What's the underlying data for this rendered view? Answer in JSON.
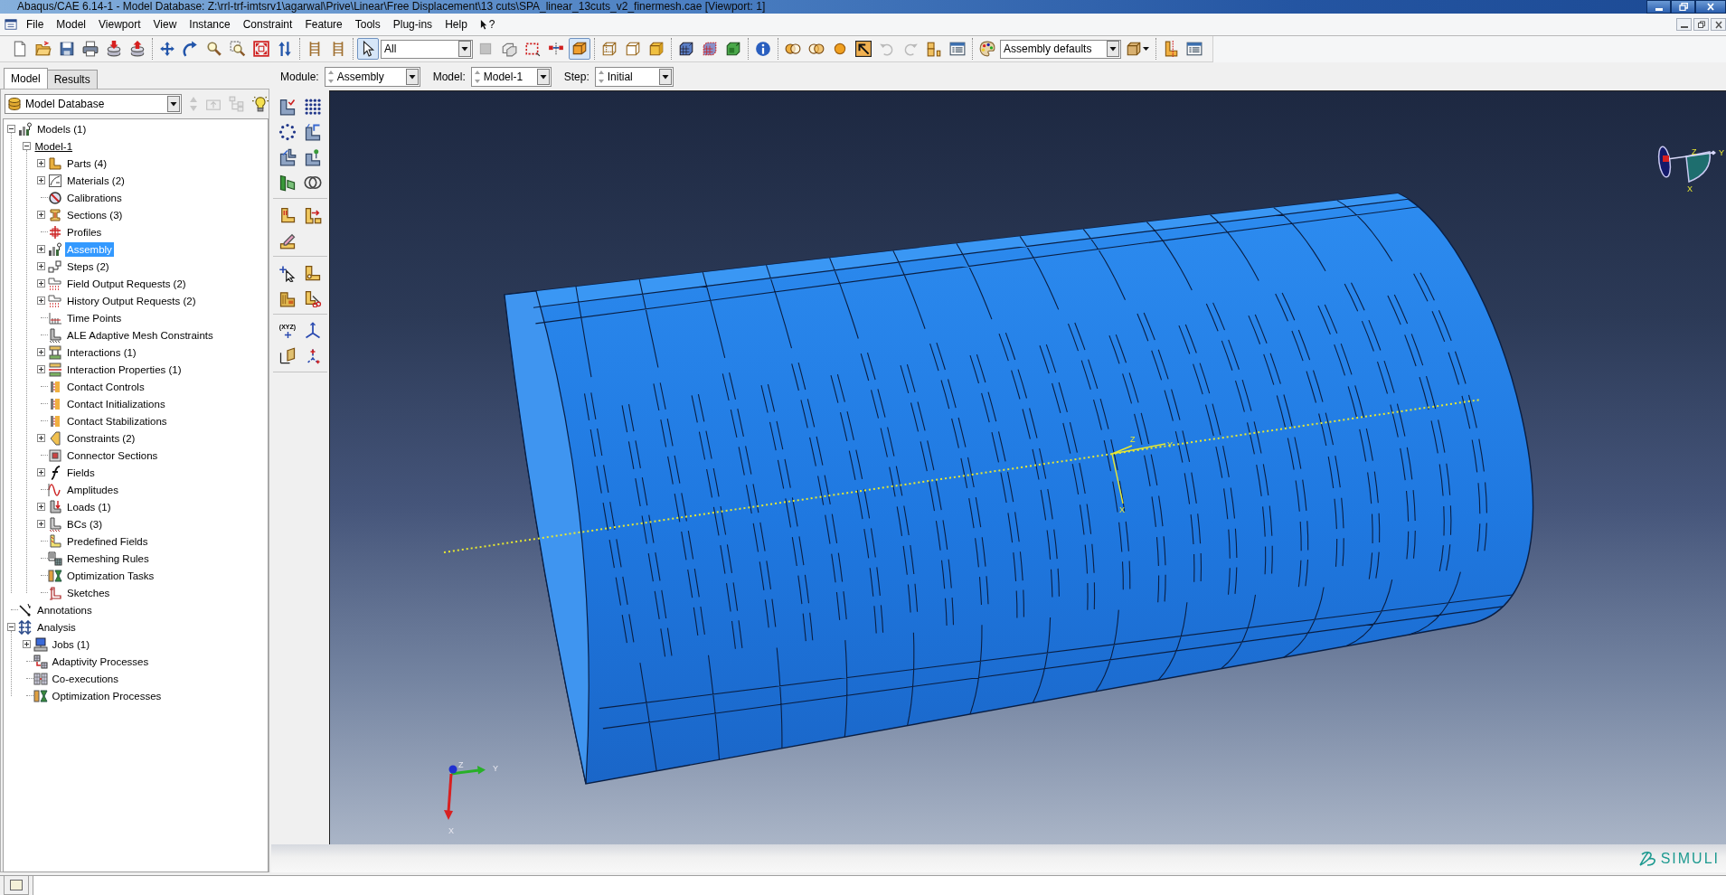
{
  "window": {
    "title": "Abaqus/CAE 6.14-1 - Model Database: Z:\\rrl-trf-imtsrv1\\agarwal\\Prive\\Linear\\Free Displacement\\13 cuts\\SPA_linear_13cuts_v2_finermesh.cae [Viewport: 1]"
  },
  "menu_bar": {
    "items": [
      {
        "kind": "menu",
        "label": "File"
      },
      {
        "kind": "menu",
        "label": "Model"
      },
      {
        "kind": "menu",
        "label": "Viewport"
      },
      {
        "kind": "menu",
        "label": "View"
      },
      {
        "kind": "menu",
        "label": "Instance"
      },
      {
        "kind": "menu",
        "label": "Constraint"
      },
      {
        "kind": "menu",
        "label": "Feature"
      },
      {
        "kind": "menu",
        "label": "Tools"
      },
      {
        "kind": "menu",
        "label": "Plug-ins"
      },
      {
        "kind": "menu",
        "label": "Help"
      },
      {
        "kind": "context_help",
        "label": "?"
      }
    ]
  },
  "toolbar": {
    "groups": [
      {
        "items": [
          {
            "kind": "button",
            "pressed": false,
            "disabled": false
          },
          {
            "kind": "button",
            "pressed": false,
            "disabled": false
          },
          {
            "kind": "button",
            "pressed": false,
            "disabled": false
          },
          {
            "kind": "button",
            "pressed": false,
            "disabled": false
          },
          {
            "kind": "button",
            "pressed": false,
            "disabled": false
          },
          {
            "kind": "button",
            "pressed": false,
            "disabled": false
          }
        ]
      },
      {
        "items": [
          {
            "kind": "button",
            "pressed": false,
            "disabled": false
          },
          {
            "kind": "button",
            "pressed": false,
            "disabled": false
          },
          {
            "kind": "button",
            "pressed": false,
            "disabled": false
          },
          {
            "kind": "button",
            "pressed": false,
            "disabled": false
          },
          {
            "kind": "button",
            "pressed": false,
            "disabled": false
          },
          {
            "kind": "button",
            "pressed": false,
            "disabled": false
          }
        ]
      },
      {
        "items": [
          {
            "kind": "button",
            "pressed": false,
            "disabled": false
          },
          {
            "kind": "button",
            "pressed": false,
            "disabled": false
          }
        ]
      },
      {
        "items": [
          {
            "kind": "button",
            "pressed": true,
            "disabled": false
          },
          {
            "kind": "combo",
            "value": "All"
          },
          {
            "kind": "button",
            "pressed": false,
            "disabled": true
          },
          {
            "kind": "button",
            "pressed": false,
            "disabled": false
          },
          {
            "kind": "button",
            "pressed": false,
            "disabled": false
          },
          {
            "kind": "button",
            "pressed": false,
            "disabled": false
          },
          {
            "kind": "button",
            "pressed": true,
            "disabled": false
          }
        ]
      },
      {
        "items": [
          {
            "kind": "button",
            "pressed": false,
            "disabled": false
          },
          {
            "kind": "button",
            "pressed": false,
            "disabled": false
          },
          {
            "kind": "button",
            "pressed": false,
            "disabled": false
          }
        ]
      },
      {
        "items": [
          {
            "kind": "button",
            "pressed": false,
            "disabled": false
          },
          {
            "kind": "button",
            "pressed": false,
            "disabled": false
          },
          {
            "kind": "button",
            "pressed": false,
            "disabled": false
          }
        ]
      },
      {
        "items": [
          {
            "kind": "button",
            "pressed": false,
            "disabled": false
          }
        ]
      },
      {
        "items": [
          {
            "kind": "button",
            "pressed": false,
            "disabled": false
          },
          {
            "kind": "button",
            "pressed": false,
            "disabled": false
          },
          {
            "kind": "button",
            "pressed": false,
            "disabled": false
          },
          {
            "kind": "button",
            "pressed": false,
            "disabled": false
          },
          {
            "kind": "button",
            "pressed": false,
            "disabled": true
          },
          {
            "kind": "button",
            "pressed": false,
            "disabled": true
          },
          {
            "kind": "button",
            "pressed": false,
            "disabled": false
          },
          {
            "kind": "button",
            "pressed": false,
            "disabled": false
          }
        ]
      },
      {
        "items": [
          {
            "kind": "button",
            "pressed": false,
            "disabled": false
          },
          {
            "kind": "combo",
            "value": "Assembly defaults"
          },
          {
            "kind": "button",
            "pressed": false,
            "disabled": false
          }
        ]
      },
      {
        "items": [
          {
            "kind": "button",
            "pressed": false,
            "disabled": false
          },
          {
            "kind": "button",
            "pressed": false,
            "disabled": false
          }
        ]
      }
    ]
  },
  "tabs": [
    {
      "label": "Model",
      "selected": true
    },
    {
      "label": "Results",
      "selected": false
    }
  ],
  "context_bar": {
    "fields": [
      {
        "label": "Module:",
        "value": "Assembly"
      },
      {
        "label": "Model:",
        "value": "Model-1"
      },
      {
        "label": "Step:",
        "value": "Initial"
      }
    ]
  },
  "model_tree": {
    "source": "Model Database",
    "tools": [
      {
        "disabled": true
      },
      {
        "disabled": true
      },
      {
        "disabled": true
      },
      {
        "disabled": false
      }
    ],
    "nodes": [
      {
        "label": "Models (1)",
        "expanded": true,
        "selected": false,
        "children": [
          {
            "label": "Model-1",
            "expanded": true,
            "selected": false,
            "current": true,
            "children": [
              {
                "label": "Parts (4)",
                "expanded": false,
                "selected": false
              },
              {
                "label": "Materials (2)",
                "expanded": false,
                "selected": false
              },
              {
                "label": "Calibrations",
                "selected": false
              },
              {
                "label": "Sections (3)",
                "expanded": false,
                "selected": false
              },
              {
                "label": "Profiles",
                "selected": false
              },
              {
                "label": "Assembly",
                "expanded": false,
                "selected": true
              },
              {
                "label": "Steps (2)",
                "expanded": false,
                "selected": false
              },
              {
                "label": "Field Output Requests (2)",
                "expanded": false,
                "selected": false
              },
              {
                "label": "History Output Requests (2)",
                "expanded": false,
                "selected": false
              },
              {
                "label": "Time Points",
                "selected": false
              },
              {
                "label": "ALE Adaptive Mesh Constraints",
                "selected": false
              },
              {
                "label": "Interactions (1)",
                "expanded": false,
                "selected": false
              },
              {
                "label": "Interaction Properties (1)",
                "expanded": false,
                "selected": false
              },
              {
                "label": "Contact Controls",
                "selected": false
              },
              {
                "label": "Contact Initializations",
                "selected": false
              },
              {
                "label": "Contact Stabilizations",
                "selected": false
              },
              {
                "label": "Constraints (2)",
                "expanded": false,
                "selected": false
              },
              {
                "label": "Connector Sections",
                "selected": false
              },
              {
                "label": "Fields",
                "expanded": false,
                "selected": false
              },
              {
                "label": "Amplitudes",
                "selected": false
              },
              {
                "label": "Loads (1)",
                "expanded": false,
                "selected": false
              },
              {
                "label": "BCs (3)",
                "expanded": false,
                "selected": false
              },
              {
                "label": "Predefined Fields",
                "selected": false
              },
              {
                "label": "Remeshing Rules",
                "selected": false
              },
              {
                "label": "Optimization Tasks",
                "selected": false
              },
              {
                "label": "Sketches",
                "selected": false
              }
            ]
          }
        ]
      },
      {
        "label": "Annotations",
        "selected": false
      },
      {
        "label": "Analysis",
        "expanded": true,
        "selected": false,
        "children": [
          {
            "label": "Jobs (1)",
            "expanded": false,
            "selected": false
          },
          {
            "label": "Adaptivity Processes",
            "selected": false
          },
          {
            "label": "Co-executions",
            "selected": false
          },
          {
            "label": "Optimization Processes",
            "selected": false
          }
        ]
      }
    ]
  },
  "tool_palette": {
    "point_label": "(XYZ)"
  },
  "viewport": {
    "view_manipulator_labels": {
      "z": "Z",
      "y": "Y",
      "x": "X"
    },
    "csys_labels": {
      "z": "Z",
      "y": "Y",
      "x": "X"
    },
    "triad_labels": {
      "z": "Z",
      "y": "Y",
      "x": "X"
    }
  },
  "brand": {
    "text": "SIMULI"
  }
}
